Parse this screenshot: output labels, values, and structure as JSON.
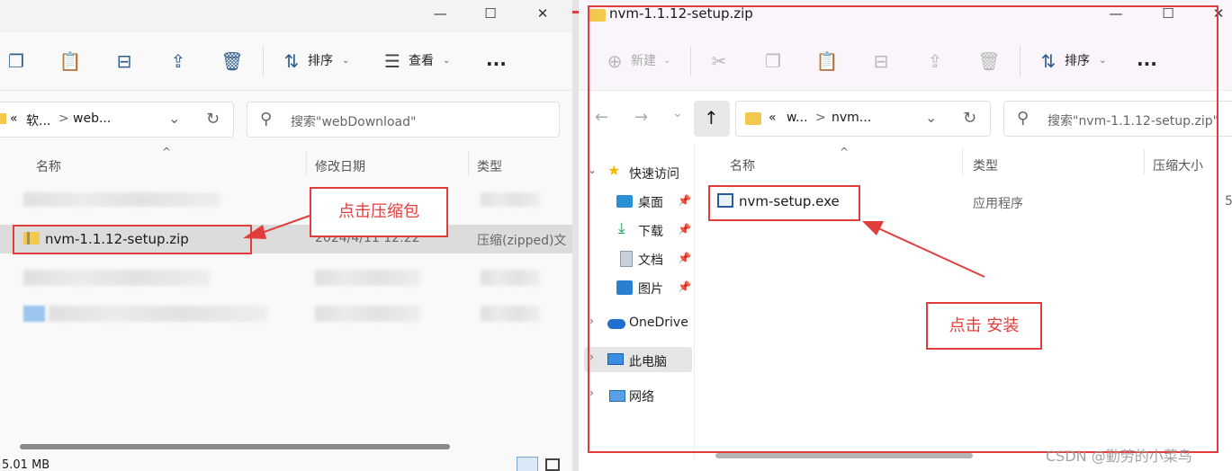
{
  "left_window": {
    "toolbar": {
      "sort_label": "排序",
      "view_label": "查看",
      "more_label": "..."
    },
    "address": {
      "back_chevrons": "«",
      "crumb_1": "软...",
      "crumb_2": "web...",
      "sep": ">"
    },
    "search": {
      "placeholder": "搜索\"webDownload\""
    },
    "columns": {
      "name": "名称",
      "modified": "修改日期",
      "type": "类型"
    },
    "rows": [
      {
        "name": "nvm-1.1.12-setup.zip",
        "modified": "2024/4/11 12:22",
        "type": "压缩(zipped)文"
      }
    ],
    "status": {
      "size": "5.01 MB"
    }
  },
  "right_window": {
    "title": "nvm-1.1.12-setup.zip",
    "toolbar": {
      "new_label": "新建",
      "sort_label": "排序",
      "more_label": "..."
    },
    "address": {
      "back_chevrons": "«",
      "crumb_1": "w...",
      "crumb_2": "nvm...",
      "sep": ">"
    },
    "search": {
      "placeholder": "搜索\"nvm-1.1.12-setup.zip\""
    },
    "nav": {
      "quick_access": "快速访问",
      "desktop": "桌面",
      "downloads": "下载",
      "documents": "文档",
      "pictures": "图片",
      "onedrive": "OneDrive",
      "this_pc": "此电脑",
      "network": "网络"
    },
    "columns": {
      "name": "名称",
      "type": "类型",
      "compressed_size": "压缩大小"
    },
    "rows": [
      {
        "name": "nvm-setup.exe",
        "type": "应用程序",
        "size_partial": "5"
      }
    ]
  },
  "annotations": {
    "callout_left": "点击压缩包",
    "callout_right": "点击 安装",
    "accent_color": "#e23d3d"
  },
  "watermark": "CSDN @勤劳的小菜鸟"
}
